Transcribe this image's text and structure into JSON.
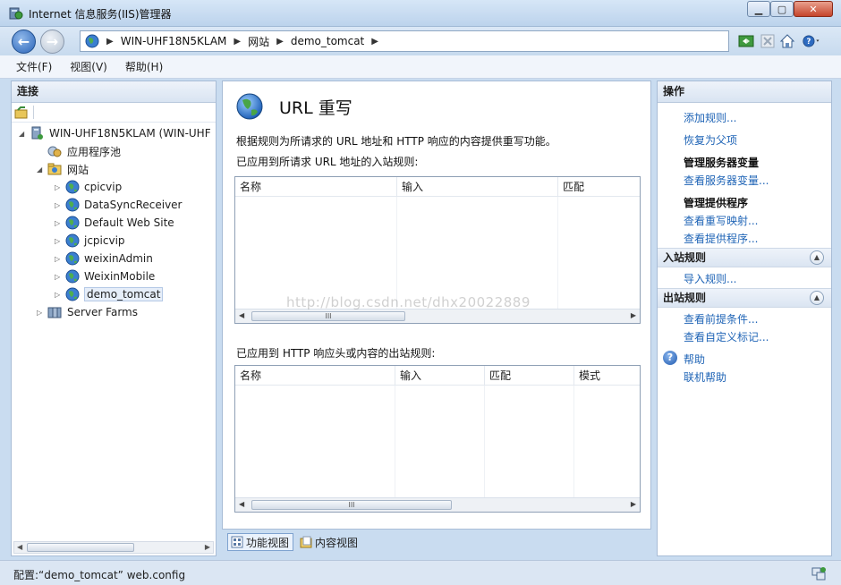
{
  "window": {
    "title": "Internet 信息服务(IIS)管理器"
  },
  "address": {
    "crumbs": [
      "WIN-UHF18N5KLAM",
      "网站",
      "demo_tomcat"
    ]
  },
  "menu": [
    "文件(F)",
    "视图(V)",
    "帮助(H)"
  ],
  "connections": {
    "header": "连接",
    "tree": [
      {
        "label": "WIN-UHF18N5KLAM (WIN-UHF",
        "level": 0,
        "icon": "server-icon",
        "expander": "collapse"
      },
      {
        "label": "应用程序池",
        "level": 1,
        "icon": "app-pool-icon",
        "expander": ""
      },
      {
        "label": "网站",
        "level": 1,
        "icon": "sites-folder-icon",
        "expander": "collapse"
      },
      {
        "label": "cpicvip",
        "level": 2,
        "icon": "website-globe-icon",
        "expander": "expand"
      },
      {
        "label": "DataSyncReceiver",
        "level": 2,
        "icon": "website-globe-icon",
        "expander": "expand"
      },
      {
        "label": "Default Web Site",
        "level": 2,
        "icon": "website-globe-icon",
        "expander": "expand"
      },
      {
        "label": "jcpicvip",
        "level": 2,
        "icon": "website-globe-icon",
        "expander": "expand"
      },
      {
        "label": "weixinAdmin",
        "level": 2,
        "icon": "website-globe-icon",
        "expander": "expand"
      },
      {
        "label": "WeixinMobile",
        "level": 2,
        "icon": "website-globe-icon",
        "expander": "expand"
      },
      {
        "label": "demo_tomcat",
        "level": 2,
        "icon": "website-globe-icon",
        "expander": "expand",
        "selected": true
      },
      {
        "label": "Server Farms",
        "level": 1,
        "icon": "server-farms-icon",
        "expander": "expand"
      }
    ]
  },
  "feature": {
    "title": "URL 重写",
    "description": "根据规则为所请求的 URL 地址和 HTTP 响应的内容提供重写功能。",
    "inbound_label": "已应用到所请求 URL 地址的入站规则:",
    "inbound_columns": [
      "名称",
      "输入",
      "匹配"
    ],
    "outbound_label": "已应用到 HTTP 响应头或内容的出站规则:",
    "outbound_columns": [
      "名称",
      "输入",
      "匹配",
      "模式"
    ],
    "scroll_grip": "III"
  },
  "watermark": "http://blog.csdn.net/dhx20022889",
  "view_tabs": [
    "功能视图",
    "内容视图"
  ],
  "actions": {
    "header": "操作",
    "items": [
      {
        "type": "link",
        "label": "添加规则..."
      },
      {
        "type": "link",
        "label": "恢复为父项"
      },
      {
        "type": "heading",
        "label": "管理服务器变量"
      },
      {
        "type": "link",
        "label": "查看服务器变量..."
      },
      {
        "type": "heading",
        "label": "管理提供程序"
      },
      {
        "type": "link",
        "label": "查看重写映射..."
      },
      {
        "type": "link",
        "label": "查看提供程序..."
      }
    ],
    "inbound_section": "入站规则",
    "inbound_items": [
      "导入规则..."
    ],
    "outbound_section": "出站规则",
    "outbound_items": [
      "查看前提条件...",
      "查看自定义标记..."
    ],
    "help_items": [
      "帮助",
      "联机帮助"
    ]
  },
  "status": {
    "text": "配置:“demo_tomcat” web.config"
  },
  "colors": {
    "link": "#1f64b6",
    "panel_border": "#a8bcd6",
    "titlebar": "#c9dcf0"
  }
}
